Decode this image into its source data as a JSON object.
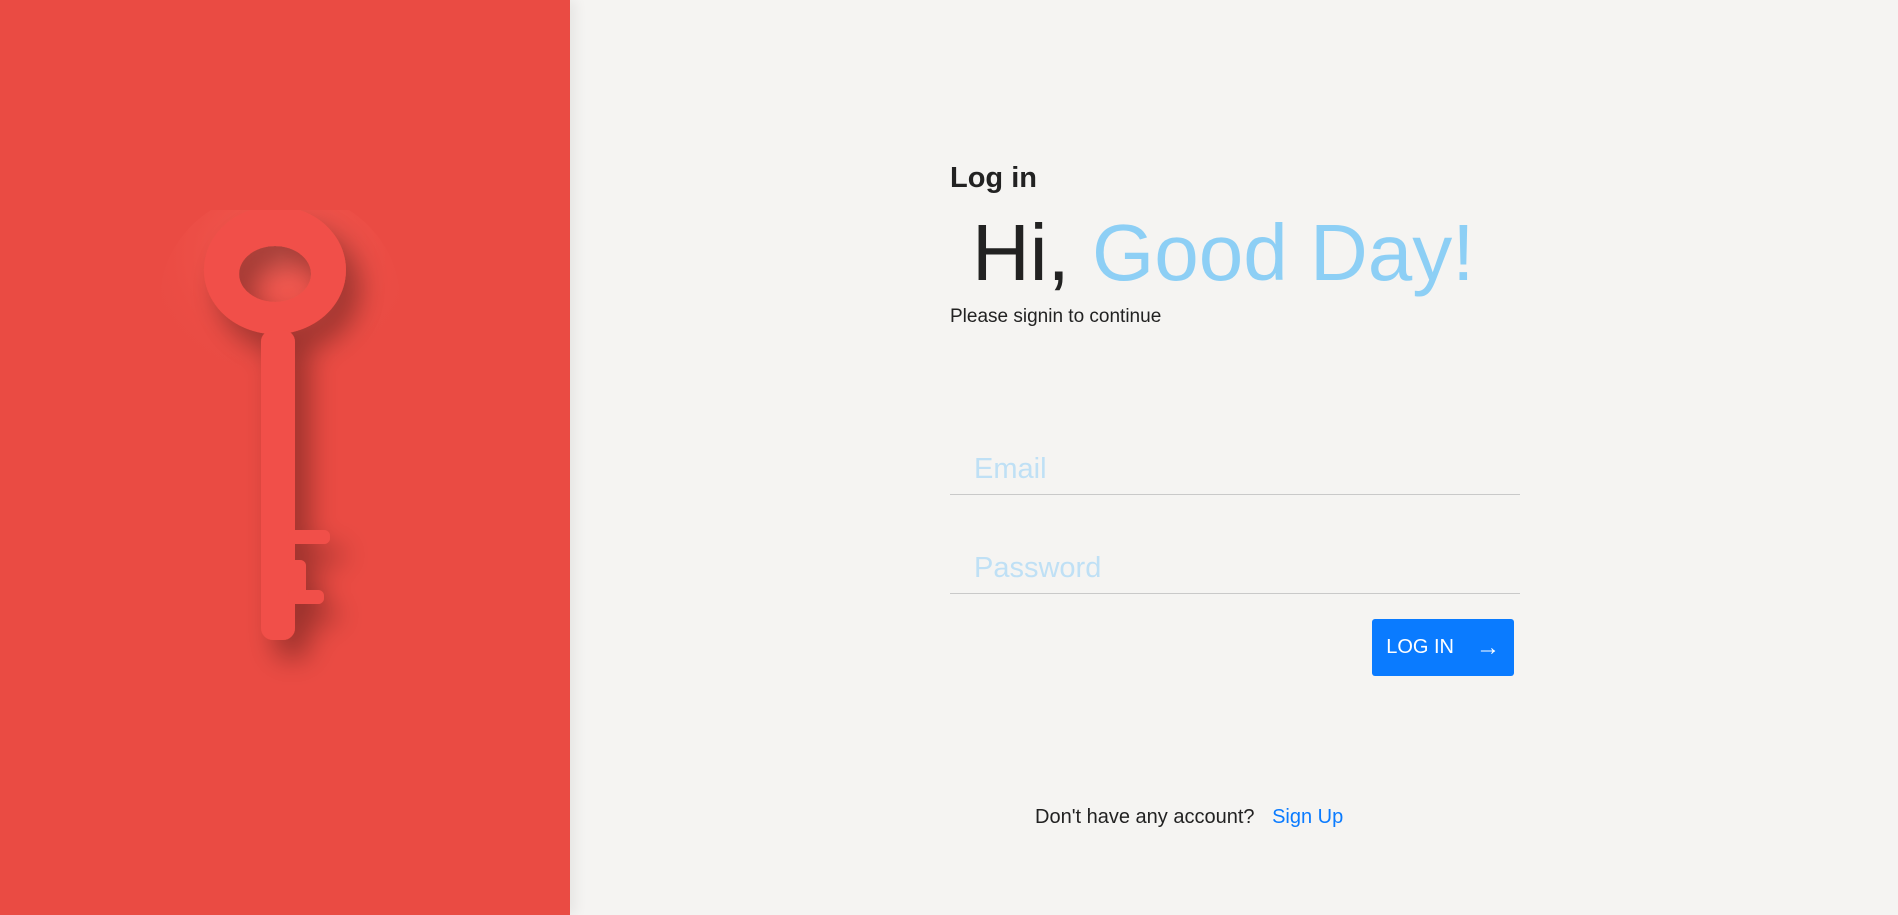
{
  "left_panel": {
    "background_color": "#ea4b43",
    "illustration_icon": "key-icon"
  },
  "form": {
    "title": "Log in",
    "greeting_plain": "Hi,",
    "greeting_accent": "Good Day!",
    "accent_color": "#8dcff5",
    "subtitle": "Please signin to continue",
    "email": {
      "value": "",
      "placeholder": "Email"
    },
    "password": {
      "value": "",
      "placeholder": "Password"
    },
    "login_button": {
      "label": "LOG IN",
      "icon": "arrow-right-icon",
      "arrow_glyph": "→",
      "color": "#0a7bff"
    }
  },
  "footer": {
    "prompt": "Don't have any account?",
    "signup_link": "Sign Up"
  }
}
